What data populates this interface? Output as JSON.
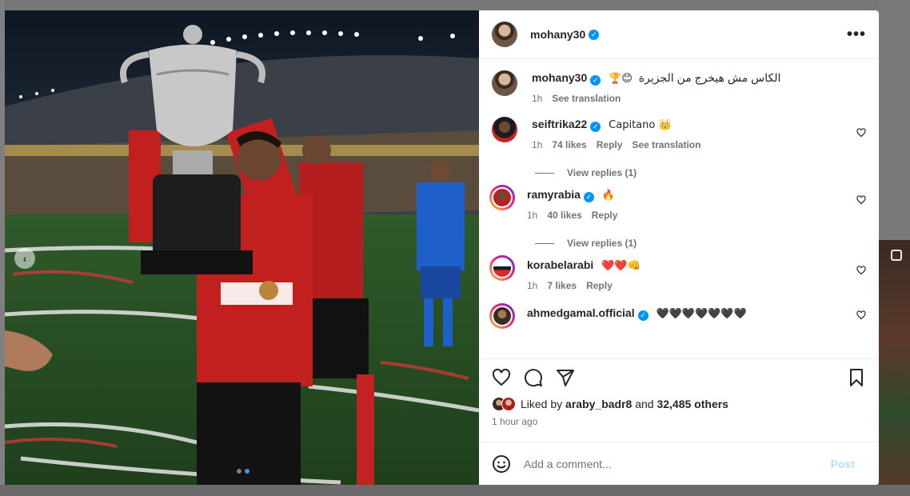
{
  "post": {
    "username": "mohany30",
    "caption": "الكاس مش هيخرج من الجزيرة",
    "caption_emoji": "🏆😊",
    "caption_time": "1h",
    "see_translation": "See translation"
  },
  "comments": [
    {
      "user": "seiftrika22",
      "text": "Capitano 👑",
      "time": "1h",
      "likes": "74 likes",
      "reply": "Reply",
      "translate": "See translation",
      "replies": "View replies (1)"
    },
    {
      "user": "ramyrabia",
      "text": "🔥",
      "time": "1h",
      "likes": "40 likes",
      "reply": "Reply",
      "replies": "View replies (1)"
    },
    {
      "user": "korabelarabi",
      "text": "❤️❤️👊",
      "time": "1h",
      "likes": "7 likes",
      "reply": "Reply"
    },
    {
      "user": "ahmedgamal.official",
      "text": "🖤🖤🖤🖤🖤🖤🖤"
    }
  ],
  "likes": {
    "prefix": "Liked by",
    "user": "araby_badr8",
    "and": "and",
    "others": "32,485 others"
  },
  "timestamp": "1 hour ago",
  "add_comment": {
    "placeholder": "Add a comment...",
    "post_label": "Post"
  },
  "colors": {
    "verified": "#0095f6",
    "post_disabled": "#b2dffc",
    "link_gray": "#737373"
  }
}
